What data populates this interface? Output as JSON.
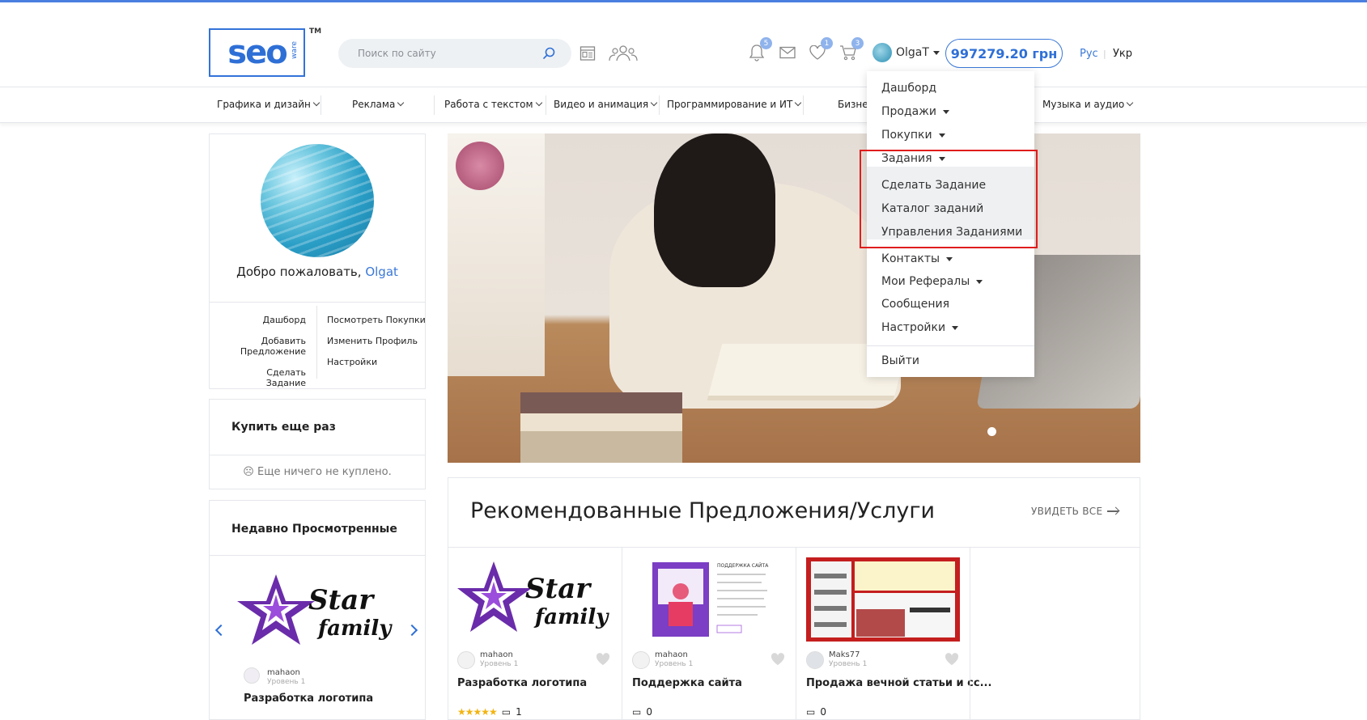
{
  "header": {
    "logo_text": "seo",
    "logo_sub": "ware",
    "logo_tm": "TM",
    "search_placeholder": "Поиск по сайту",
    "badges": {
      "notifications": "5",
      "favorites": "1",
      "cart": "3"
    },
    "username": "OlgaT",
    "balance": "997279.20 грн",
    "lang_ru": "Рус",
    "lang_uk": "Укр",
    "accent_color": "#2e6fd6"
  },
  "nav": {
    "items": [
      "Графика и дизайн",
      "Реклама",
      "Работа с текстом",
      "Видео и анимация",
      "Программирование и ИТ",
      "Бизне",
      "Музыка и аудио"
    ]
  },
  "sidebar": {
    "welcome_prefix": "Добро пожаловать,",
    "welcome_name": "Olgat",
    "quick_links_left": [
      "Дашборд",
      "Добавить Предложение",
      "Сделать Задание"
    ],
    "quick_links_right": [
      "Посмотреть Покупки",
      "Изменить Профиль",
      "Настройки"
    ],
    "buy_again_title": "Купить еще раз",
    "buy_again_empty": "Еще ничего не куплено.",
    "recent_title": "Недавно Просмотренные",
    "recent_item": {
      "seller": "mahaon",
      "level": "Уровень 1",
      "title": "Разработка логотипа"
    }
  },
  "main": {
    "recommended_title": "Рекомендованные Предложения/Услуги",
    "see_all": "УВИДЕТЬ ВСЕ",
    "cards": [
      {
        "seller": "mahaon",
        "level": "Уровень 1",
        "title": "Разработка логотипа",
        "rating": 5,
        "reviews": "1"
      },
      {
        "seller": "mahaon",
        "level": "Уровень 1",
        "title": "Поддержка сайта",
        "reviews": "0"
      },
      {
        "seller": "Maks77",
        "level": "Уровень 1",
        "title": "Продажа вечной статьи и сс...",
        "reviews": "0"
      }
    ]
  },
  "user_menu": {
    "items": [
      "Дашборд",
      "Продажи",
      "Покупки",
      "Задания"
    ],
    "sub_items": [
      "Сделать Задание",
      "Каталог заданий",
      "Управления Заданиями"
    ],
    "more_items": [
      "Контакты",
      "Мои Рефералы",
      "Сообщения",
      "Настройки"
    ],
    "logout": "Выйти",
    "highlight_color": "#e01c1c"
  }
}
